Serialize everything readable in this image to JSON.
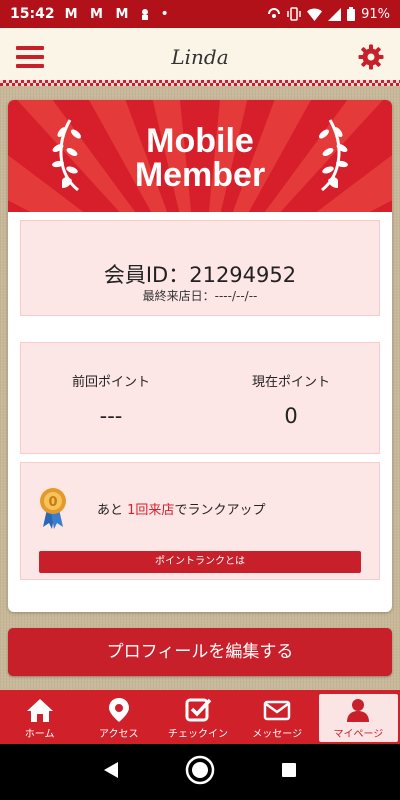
{
  "status_bar": {
    "time": "15:42",
    "notifications": "M M M",
    "battery": "91%"
  },
  "header": {
    "logo": "Linda"
  },
  "card": {
    "banner_title_line1": "Mobile",
    "banner_title_line2": "Member",
    "member_id_text": "会員ID：21294952",
    "last_visit_text": "最終来店日：----/--/--",
    "prev_points_label": "前回ポイント",
    "prev_points_value": "---",
    "current_points_label": "現在ポイント",
    "current_points_value": "0",
    "rank_prefix": "あと",
    "rank_highlight": "1回来店",
    "rank_suffix": "でランクアップ",
    "rank_button_label": "ポイントランクとは"
  },
  "edit_profile_label": "プロフィールを編集する",
  "tabs": [
    {
      "label": "ホーム",
      "icon": "home-icon"
    },
    {
      "label": "アクセス",
      "icon": "map-pin-icon"
    },
    {
      "label": "チェックイン",
      "icon": "checkin-icon"
    },
    {
      "label": "メッセージ",
      "icon": "mail-icon"
    },
    {
      "label": "マイページ",
      "icon": "user-icon",
      "active": true
    }
  ],
  "colors": {
    "brand_red": "#c8202a",
    "panel_pink": "#fde6e6",
    "highlight_red": "#d61f2a"
  }
}
